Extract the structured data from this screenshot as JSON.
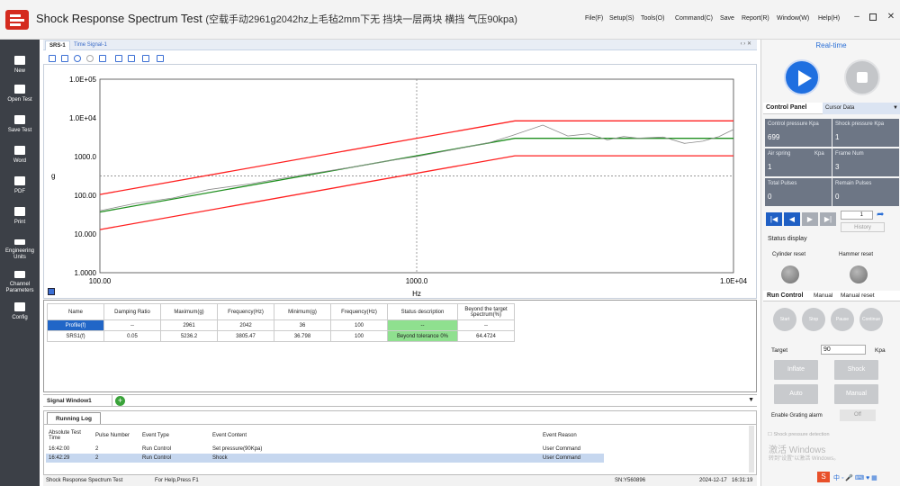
{
  "app": {
    "title": "Shock Response Spectrum Test",
    "subtitle": "(空载手动2961g2042hz上毛毡2mm下无  挡块一层两块  横挡  气压90kpa)",
    "menu": [
      "File(F)",
      "Setup(S)",
      "Tools(O)",
      "Command(C)",
      "Save",
      "Report(R)",
      "Window(W)",
      "Help(H)"
    ]
  },
  "sidebar": {
    "items": [
      {
        "label": "New",
        "icon": "new-icon"
      },
      {
        "label": "Open Test",
        "icon": "folder-open-icon"
      },
      {
        "label": "Save Test",
        "icon": "save-icon"
      },
      {
        "label": "Word",
        "icon": "word-icon"
      },
      {
        "label": "PDF",
        "icon": "pdf-icon"
      },
      {
        "label": "Print",
        "icon": "print-icon"
      },
      {
        "label": "Engineering Units",
        "icon": "ruler-icon"
      },
      {
        "label": "Channel Parameters",
        "icon": "sliders-icon"
      },
      {
        "label": "Config",
        "icon": "layers-icon"
      }
    ]
  },
  "tabs": [
    "SRS-1",
    "Time Signal-1"
  ],
  "chart_data": {
    "type": "line",
    "xlabel": "Hz",
    "ylabel": "g",
    "xscale": "log",
    "yscale": "log",
    "xlim": [
      100,
      10000
    ],
    "ylim": [
      1,
      100000
    ],
    "xticks": [
      "100.00",
      "1000.0",
      "1.0E+04"
    ],
    "yticks": [
      "1.0E+05",
      "1.0E+04",
      "1000.0",
      "100.00",
      "10.000",
      "1.0000"
    ],
    "grid": "center crosshair dashed",
    "series": [
      {
        "color": "#ff2020",
        "x": [
          100,
          2042,
          10000
        ],
        "y": [
          105,
          8362,
          8362
        ]
      },
      {
        "color": "#ff2020",
        "x": [
          100,
          2042,
          10000
        ],
        "y": [
          13,
          1050,
          1050
        ]
      },
      {
        "color": "#1f8f1f",
        "x": [
          100,
          2042,
          10000
        ],
        "y": [
          37,
          2961,
          2961
        ]
      },
      {
        "color": "#8a8a8a",
        "x": [
          100,
          130,
          170,
          220,
          300,
          400,
          500,
          650,
          800,
          1000,
          1300,
          1700,
          2000,
          2500,
          3000,
          3500,
          4000,
          4500,
          5000,
          6000,
          7000,
          8000,
          9000,
          10000
        ],
        "y": [
          40,
          62,
          85,
          140,
          200,
          300,
          400,
          560,
          760,
          1000,
          1500,
          2300,
          3500,
          6500,
          3400,
          3900,
          2700,
          3300,
          3000,
          3200,
          2200,
          2500,
          3300,
          5000
        ]
      }
    ]
  },
  "results": {
    "headers": [
      "Name",
      "Damping Ratio",
      "Maximum(g)",
      "Frequency(Hz)",
      "Minimum(g)",
      "Frequency(Hz)",
      "Status description",
      "Beyond the target spectrum(%)"
    ],
    "rows": [
      [
        "Profile(f)",
        "--",
        "2961",
        "2042",
        "36",
        "100",
        "--",
        "--"
      ],
      [
        "SRS1(f)",
        "0.05",
        "5236.2",
        "3805.47",
        "36.798",
        "100",
        "Beyond tolerance 0%",
        "64.4724"
      ]
    ]
  },
  "signal_window": {
    "label": "Signal Window1"
  },
  "log": {
    "tab": "Running Log",
    "headers": [
      "Absolute Test Time",
      "Pulse Number",
      "Event Type",
      "Event Content",
      "Event Reason"
    ],
    "rows": [
      [
        "16:42:00",
        "2",
        "Run Control",
        "Set pressure(90Kpa)",
        "User Command"
      ],
      [
        "16:42:29",
        "2",
        "Run Control",
        "Shock",
        "User Command"
      ]
    ]
  },
  "statusbar": {
    "app": "Shock Response Spectrum Test",
    "help": "For Help,Press F1",
    "sn": "SN:Y560896",
    "date": "2024-12-17",
    "time": "16:31:19"
  },
  "realtime": {
    "header": "Real-time",
    "control_panel": "Control Panel",
    "cursor_data": "Cursor Data",
    "tiles": [
      {
        "label": "Control pressure Kpa",
        "value": "699"
      },
      {
        "label": "Shock pressure Kpa",
        "value": "1"
      },
      {
        "label": "Air spring",
        "unit": "Kpa",
        "value": "1"
      },
      {
        "label": "Frame Num",
        "value": "3"
      },
      {
        "label": "Total Pulses",
        "value": "0"
      },
      {
        "label": "Remain Pulses",
        "value": "0"
      }
    ],
    "frame_value": "1",
    "history": "History",
    "status_display": "Status display",
    "cylinder_reset": "Cylinder reset",
    "hammer_reset": "Hammer reset",
    "run_tabs": [
      "Run Control",
      "Manual",
      "Manual reset"
    ],
    "circles": [
      "Start",
      "Stop",
      "Pause",
      "Continue"
    ],
    "target_label": "Target",
    "target_value": "90",
    "target_unit": "Kpa",
    "buttons": [
      "Inflate",
      "Shock",
      "Auto",
      "Manual"
    ],
    "grating_label": "Enable Grating alarm",
    "grating_toggle": "Off",
    "pressure_detection": "Shock pressure detection",
    "watermark1": "激活 Windows",
    "watermark2": "转到\"设置\"以激活 Windows。"
  }
}
